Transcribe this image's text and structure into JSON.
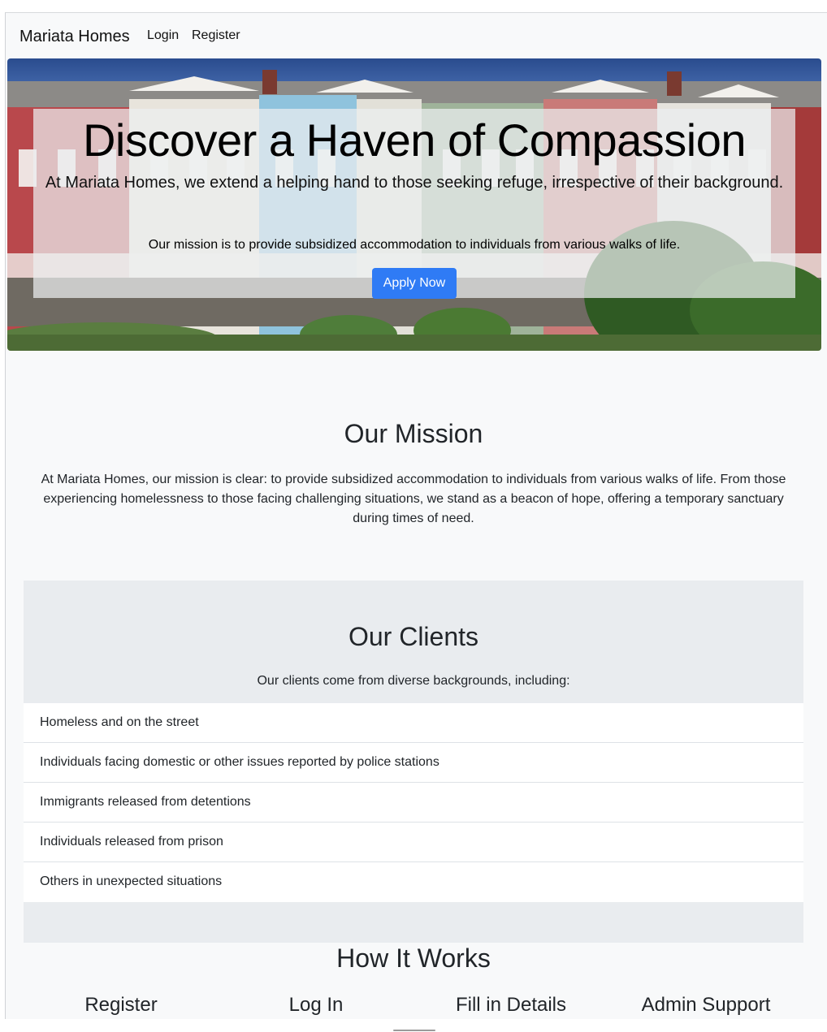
{
  "navbar": {
    "brand": "Mariata Homes",
    "links": [
      "Login",
      "Register"
    ]
  },
  "hero": {
    "title": "Discover a Haven of Compassion",
    "lead": "At Mariata Homes, we extend a helping hand to those seeking refuge, irrespective of their background.",
    "subtext": "Our mission is to provide subsidized accommodation to individuals from various walks of life.",
    "cta_label": "Apply Now",
    "cta_color": "#2f7bf5"
  },
  "mission": {
    "title": "Our Mission",
    "text": "At Mariata Homes, our mission is clear: to provide subsidized accommodation to individuals from various walks of life. From those experiencing homelessness to those facing challenging situations, we stand as a beacon of hope, offering a temporary sanctuary during times of need."
  },
  "clients": {
    "title": "Our Clients",
    "intro": "Our clients come from diverse backgrounds, including:",
    "items": [
      "Homeless and on the street",
      "Individuals facing domestic or other issues reported by police stations",
      "Immigrants released from detentions",
      "Individuals released from prison",
      "Others in unexpected situations"
    ]
  },
  "how_it_works": {
    "title": "How It Works",
    "steps": [
      "Register",
      "Log In",
      "Fill in Details",
      "Admin Support"
    ]
  }
}
